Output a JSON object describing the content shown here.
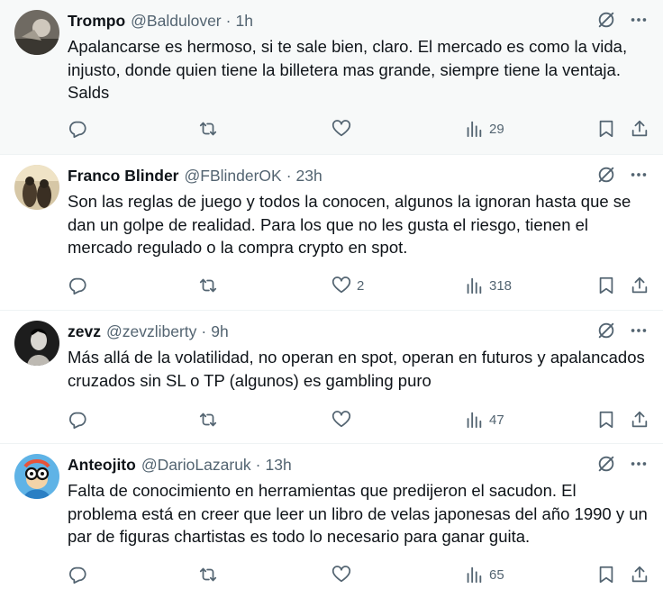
{
  "colors": {
    "text": "#0f1419",
    "secondary": "#536471",
    "highlight_bg": "#f7f9f9",
    "divider": "#eff3f4"
  },
  "icons": {
    "top": [
      "grok-slash-icon",
      "more-icon"
    ],
    "actions": [
      "reply-icon",
      "retweet-icon",
      "like-icon",
      "views-icon",
      "bookmark-icon",
      "share-icon"
    ]
  },
  "tweets": [
    {
      "name": "Trompo",
      "handle": "@Baldulover",
      "time": "1h",
      "text": "Apalancarse es hermoso, si te sale bien, claro. El mercado es como la vida, injusto, donde quien tiene la billetera mas grande, siempre tiene la ventaja. Salds",
      "replies": "",
      "retweets": "",
      "likes": "",
      "views": "29"
    },
    {
      "name": "Franco Blinder",
      "handle": "@FBlinderOK",
      "time": "23h",
      "text": "Son las reglas de juego y todos la conocen, algunos la ignoran hasta que se dan un golpe de realidad. Para los que no les gusta el riesgo, tienen el mercado regulado o la compra crypto en spot.",
      "replies": "",
      "retweets": "",
      "likes": "2",
      "views": "318"
    },
    {
      "name": "zevz",
      "handle": "@zevzliberty",
      "time": "9h",
      "text": "Más allá de la volatilidad, no operan en spot, operan en futuros y apalancados cruzados sin SL o TP (algunos) es gambling puro",
      "replies": "",
      "retweets": "",
      "likes": "",
      "views": "47"
    },
    {
      "name": "Anteojito",
      "handle": "@DarioLazaruk",
      "time": "13h",
      "text": "Falta de conocimiento en herramientas que predijeron el sacudon. El problema está en creer que leer un libro de velas japonesas del año 1990 y un par de figuras chartistas es todo lo necesario para ganar guita.",
      "replies": "",
      "retweets": "",
      "likes": "",
      "views": "65"
    }
  ]
}
